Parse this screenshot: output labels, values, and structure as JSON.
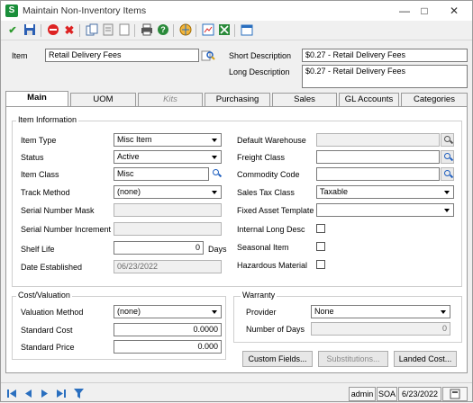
{
  "window": {
    "title": "Maintain Non-Inventory Items",
    "app_icon": "S"
  },
  "toolbar": {
    "icons": [
      "accept-icon",
      "save-icon",
      "delete-icon",
      "cancel-icon",
      "copy-icon",
      "notes-icon",
      "attachment-icon",
      "print-icon",
      "help-icon",
      "web-icon",
      "report-icon",
      "export-icon",
      "calendar-icon"
    ]
  },
  "header": {
    "item_label": "Item",
    "item_value": "Retail Delivery Fees",
    "short_desc_label": "Short Description",
    "short_desc_value": "$0.27 - Retail Delivery Fees",
    "long_desc_label": "Long Description",
    "long_desc_value": "$0.27 - Retail Delivery Fees"
  },
  "tabs": [
    {
      "label": "Main",
      "active": true
    },
    {
      "label": "UOM"
    },
    {
      "label": "Kits",
      "disabled": true
    },
    {
      "label": "Purchasing"
    },
    {
      "label": "Sales"
    },
    {
      "label": "GL Accounts"
    },
    {
      "label": "Categories"
    }
  ],
  "item_info": {
    "group_label": "Item Information",
    "item_type": {
      "label": "Item Type",
      "value": "Misc Item"
    },
    "status": {
      "label": "Status",
      "value": "Active"
    },
    "item_class": {
      "label": "Item Class",
      "value": "Misc"
    },
    "track_method": {
      "label": "Track Method",
      "value": "(none)"
    },
    "serial_mask": {
      "label": "Serial Number Mask",
      "value": ""
    },
    "serial_increment": {
      "label": "Serial Number Increment",
      "value": ""
    },
    "shelf_life": {
      "label": "Shelf Life",
      "value": "0",
      "unit": "Days"
    },
    "date_established": {
      "label": "Date Established",
      "value": "06/23/2022"
    },
    "default_warehouse": {
      "label": "Default Warehouse",
      "value": ""
    },
    "freight_class": {
      "label": "Freight Class",
      "value": ""
    },
    "commodity_code": {
      "label": "Commodity Code",
      "value": ""
    },
    "sales_tax_class": {
      "label": "Sales Tax Class",
      "value": "Taxable"
    },
    "fixed_asset_template": {
      "label": "Fixed Asset Template",
      "value": ""
    },
    "internal_long_desc": {
      "label": "Internal Long Desc",
      "checked": false
    },
    "seasonal_item": {
      "label": "Seasonal Item",
      "checked": false
    },
    "hazardous_material": {
      "label": "Hazardous Material",
      "checked": false
    }
  },
  "cost_valuation": {
    "group_label": "Cost/Valuation",
    "valuation_method": {
      "label": "Valuation Method",
      "value": "(none)"
    },
    "standard_cost": {
      "label": "Standard Cost",
      "value": "0.0000"
    },
    "standard_price": {
      "label": "Standard Price",
      "value": "0.000"
    }
  },
  "warranty": {
    "group_label": "Warranty",
    "provider": {
      "label": "Provider",
      "value": "None"
    },
    "number_of_days": {
      "label": "Number of Days",
      "value": "0"
    }
  },
  "buttons": {
    "custom_fields": "Custom Fields...",
    "substitutions": "Substitutions...",
    "landed_cost": "Landed Cost..."
  },
  "statusbar": {
    "user": "admin",
    "company": "SOA",
    "date": "6/23/2022"
  }
}
